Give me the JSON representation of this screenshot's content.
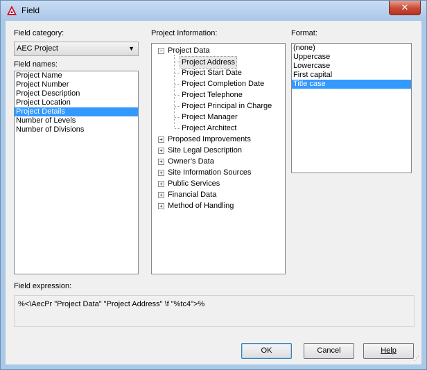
{
  "window": {
    "title": "Field",
    "close_glyph": "✕"
  },
  "labels": {
    "field_category": "Field category:",
    "field_names": "Field names:",
    "project_information": "Project Information:",
    "format": "Format:",
    "field_expression": "Field expression:"
  },
  "category": {
    "selected": "AEC Project"
  },
  "field_names": {
    "items": [
      "Project Name",
      "Project Number",
      "Project Description",
      "Project Location",
      "Project Details",
      "Number of Levels",
      "Number of Divisions"
    ],
    "selected_index": 4
  },
  "tree": {
    "root": "Project Data",
    "children": [
      "Project Address",
      "Project Start Date",
      "Project Completion Date",
      "Project Telephone",
      "Project Principal in Charge",
      "Project Manager",
      "Project Architect"
    ],
    "selected_child": 0,
    "collapsed": [
      "Proposed Improvements",
      "Site Legal Description",
      "Owner’s Data",
      "Site Information Sources",
      "Public Services",
      "Financial Data",
      "Method of Handling"
    ]
  },
  "format": {
    "items": [
      "(none)",
      "Uppercase",
      "Lowercase",
      "First capital",
      "Title case"
    ],
    "selected_index": 4
  },
  "expression": "%<\\AecPr \"Project Data\" \"Project Address\" \\f \"%tc4\">%",
  "buttons": {
    "ok": "OK",
    "cancel": "Cancel",
    "help": "Help"
  },
  "colors": {
    "selection": "#3399ff",
    "accent_close": "#c74a37"
  }
}
